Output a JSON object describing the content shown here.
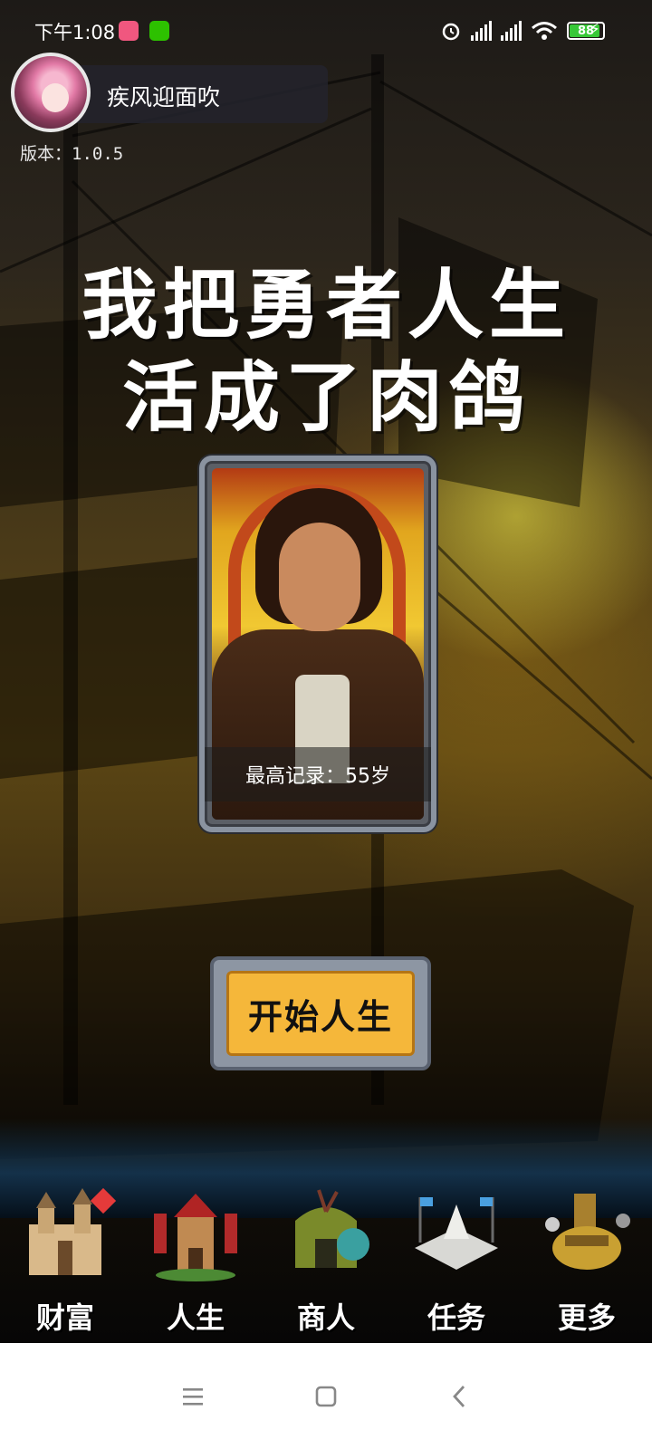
{
  "status_bar": {
    "time": "下午1:08",
    "network_1": "HD",
    "network_2": "HD",
    "battery_level": "88"
  },
  "profile": {
    "username": "疾风迎面吹",
    "version": "版本：1.0.5"
  },
  "title": {
    "line1": "我把勇者人生",
    "line2": "活成了肉鸽"
  },
  "hero_card": {
    "record_text": "最高记录：55岁"
  },
  "start_button": {
    "label": "开始人生"
  },
  "nav": {
    "items": [
      {
        "label": "财富",
        "icon": "castle-icon",
        "has_badge": true
      },
      {
        "label": "人生",
        "icon": "tower-icon",
        "has_badge": false
      },
      {
        "label": "商人",
        "icon": "merchant-tent-icon",
        "has_badge": false
      },
      {
        "label": "任务",
        "icon": "quest-altar-icon",
        "has_badge": false
      },
      {
        "label": "更多",
        "icon": "workshop-icon",
        "has_badge": false
      }
    ]
  },
  "system_nav": {
    "menu_icon": "menu-icon",
    "home_icon": "home-icon",
    "back_icon": "back-icon"
  },
  "colors": {
    "accent_button": "#f5b73a",
    "badge_red": "#e43a3a",
    "battery_green": "#37c837"
  }
}
